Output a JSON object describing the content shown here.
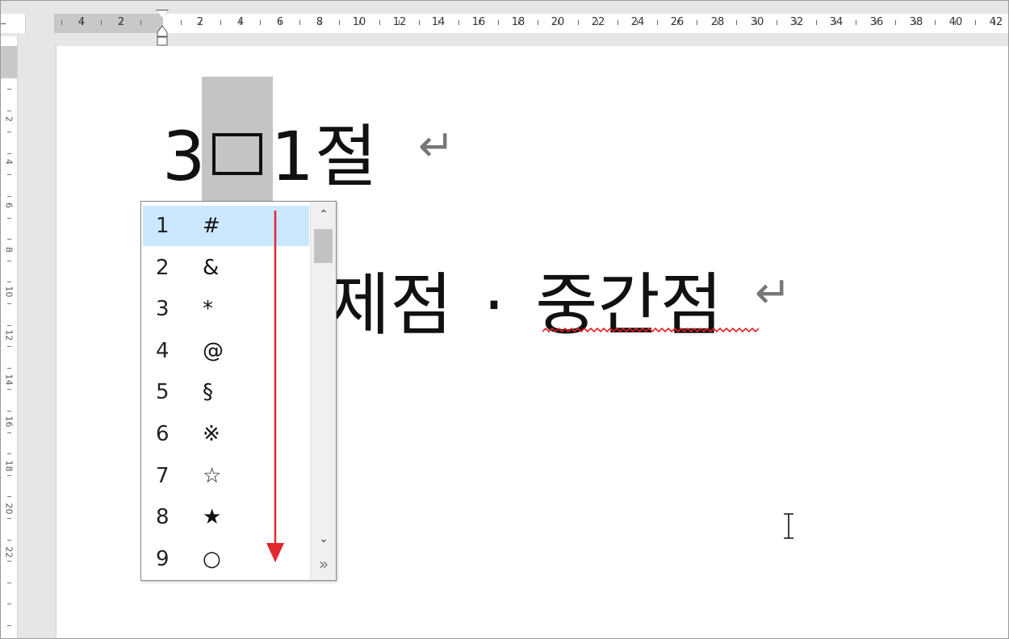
{
  "ruler": {
    "numbers": [
      "4",
      "2",
      "2",
      "4",
      "6",
      "8",
      "10",
      "12",
      "14",
      "16",
      "18",
      "20",
      "22",
      "24",
      "26",
      "28",
      "30",
      "32",
      "34",
      "36",
      "38",
      "40",
      "42"
    ]
  },
  "vruler": {
    "numbers": [
      "2",
      "4",
      "6",
      "8",
      "10",
      "12",
      "14",
      "16",
      "18",
      "20",
      "22"
    ]
  },
  "document": {
    "line1_prefix": "3",
    "line1_suffix": "1절",
    "line2_start": "제점",
    "line2_dot": "·",
    "line2_end": "중간점",
    "paragraph_mark": "↵"
  },
  "symbol_popup": {
    "items": [
      {
        "number": "1",
        "symbol": "#"
      },
      {
        "number": "2",
        "symbol": "&"
      },
      {
        "number": "3",
        "symbol": "*"
      },
      {
        "number": "4",
        "symbol": "@"
      },
      {
        "number": "5",
        "symbol": "§"
      },
      {
        "number": "6",
        "symbol": "※"
      },
      {
        "number": "7",
        "symbol": "☆"
      },
      {
        "number": "8",
        "symbol": "★"
      },
      {
        "number": "9",
        "symbol": "○"
      }
    ],
    "selected_index": 0,
    "scroll_up_icon": "chevron-up-icon",
    "scroll_down_icon": "chevron-down-icon",
    "expand_icon": "double-chevron-right-icon"
  },
  "colors": {
    "selection_highlight": "#c4c4c4",
    "list_selected": "#cce8ff",
    "annotation_arrow": "#e0282e",
    "spellcheck": "#e02020"
  }
}
